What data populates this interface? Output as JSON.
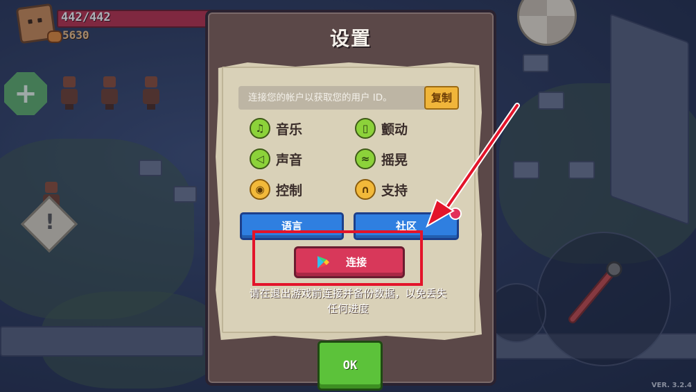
{
  "hud": {
    "hp_text": "442/442",
    "coins_text": "5630",
    "add_icon": "plus-icon",
    "warning_icon": "exclamation-icon"
  },
  "dialog": {
    "title": "设置",
    "user_id_placeholder": "连接您的帐户以获取您的用户 ID。",
    "copy_label": "复制",
    "options": [
      {
        "label": "音乐",
        "icon": "music-note-icon"
      },
      {
        "label": "颤动",
        "icon": "vibration-icon"
      },
      {
        "label": "声音",
        "icon": "speaker-icon"
      },
      {
        "label": "摇晃",
        "icon": "shake-icon"
      },
      {
        "label": "控制",
        "icon": "gamepad-icon"
      },
      {
        "label": "支持",
        "icon": "headset-icon"
      }
    ],
    "language_label": "语言",
    "community_label": "社区",
    "connect_label": "连接",
    "connect_icon": "google-play-icon",
    "hint_line1": "请在退出游戏前连接并备份数据，以免丢失",
    "hint_line2": "任何进度",
    "ok_label": "OK"
  },
  "footer": {
    "version": "VER. 3.2.4"
  },
  "colors": {
    "accent_red_annotation": "#e3142a",
    "connect_button": "#d8385a",
    "blue_button": "#2f7fe0",
    "ok_button": "#5cc23a",
    "copy_button": "#f0b53a"
  }
}
